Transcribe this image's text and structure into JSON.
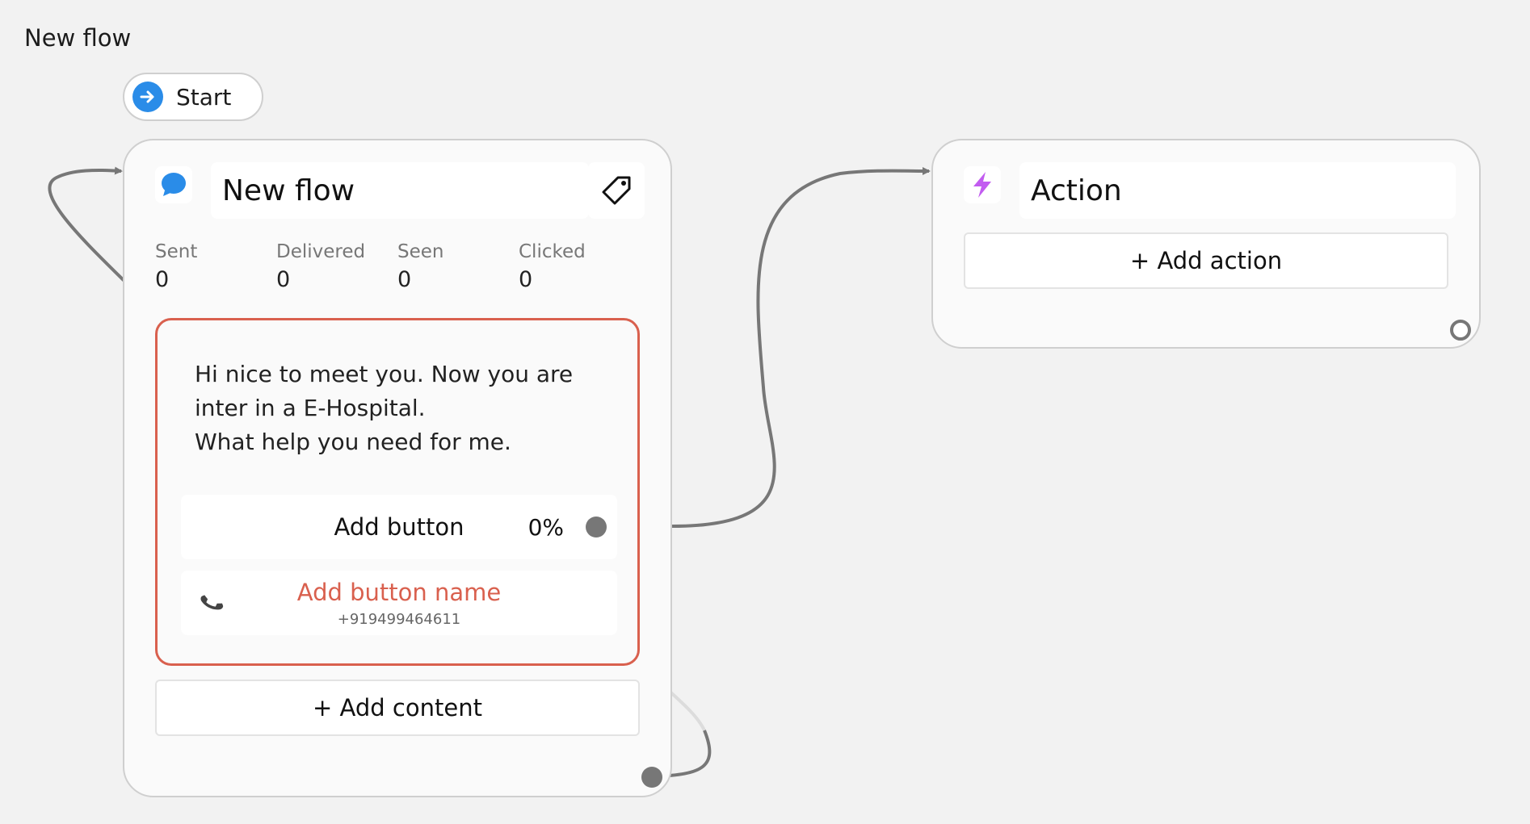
{
  "page": {
    "title": "New flow"
  },
  "start": {
    "label": "Start",
    "icon": "arrow-right-icon"
  },
  "message_node": {
    "title": "New flow",
    "icon": "chat-bubble-icon",
    "tag_icon": "tag-icon",
    "stats": [
      {
        "label": "Sent",
        "value": "0"
      },
      {
        "label": "Delivered",
        "value": "0"
      },
      {
        "label": "Seen",
        "value": "0"
      },
      {
        "label": "Clicked",
        "value": "0"
      }
    ],
    "message_text": "Hi nice to meet you. Now you are\ninter in a E-Hospital.\nWhat help you need for me.",
    "add_button": {
      "label": "Add button",
      "percent": "0%"
    },
    "phone_button": {
      "name": "Add button name",
      "number": "+919499464611",
      "icon": "phone-icon"
    },
    "add_content_label": "+ Add content"
  },
  "action_node": {
    "title": "Action",
    "icon": "lightning-icon",
    "add_action_label": "+ Add action"
  },
  "colors": {
    "accent_blue": "#2a8ce8",
    "error_red": "#d9604e",
    "action_purple": "#c25cf0",
    "connector_gray": "#777777"
  }
}
